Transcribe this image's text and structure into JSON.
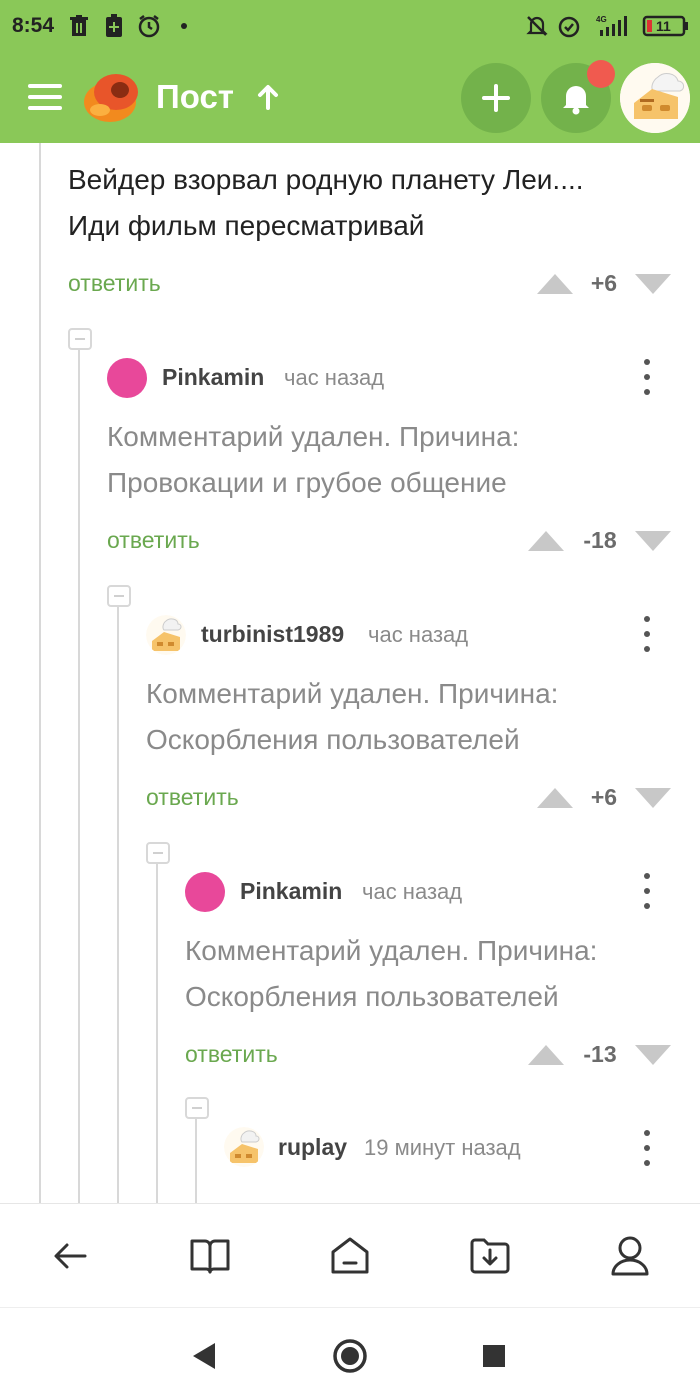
{
  "status_bar": {
    "time": "8:54",
    "battery": "11",
    "network": "4G"
  },
  "header": {
    "title": "Пост",
    "accent_color": "#8ac858",
    "button_color": "#73b24b",
    "notification_dot_color": "#f05a4f"
  },
  "comments": {
    "main": {
      "text_lines": [
        "Вейдер взорвал родную планету Леи....",
        "Иди фильм пересматривай"
      ],
      "reply": "ответить",
      "rating": "+6"
    },
    "c1": {
      "user": "Pinkamin",
      "time": "час назад",
      "text_lines": [
        "Комментарий удален. Причина:",
        "Провокации и грубое общение"
      ],
      "reply": "ответить",
      "rating": "-18"
    },
    "c2": {
      "user": "turbinist1989",
      "time": "час назад",
      "text_lines": [
        "Комментарий удален. Причина:",
        "Оскорбления пользователей"
      ],
      "reply": "ответить",
      "rating": "+6"
    },
    "c3": {
      "user": "Pinkamin",
      "time": "час назад",
      "text_lines": [
        "Комментарий удален. Причина:",
        "Оскорбления пользователей"
      ],
      "reply": "ответить",
      "rating": "-13"
    },
    "c4": {
      "user": "ruplay",
      "time": "19 минут назад"
    }
  },
  "icons": {
    "header": [
      "menu-icon",
      "pikabu-logo",
      "arrow-up-icon",
      "plus-icon",
      "bell-icon",
      "user-avatar"
    ],
    "bottom_nav": [
      "back-icon",
      "book-icon",
      "feed-icon",
      "saved-icon",
      "profile-icon"
    ],
    "system_nav": [
      "back-triangle-icon",
      "home-circle-icon",
      "recents-square-icon"
    ]
  }
}
